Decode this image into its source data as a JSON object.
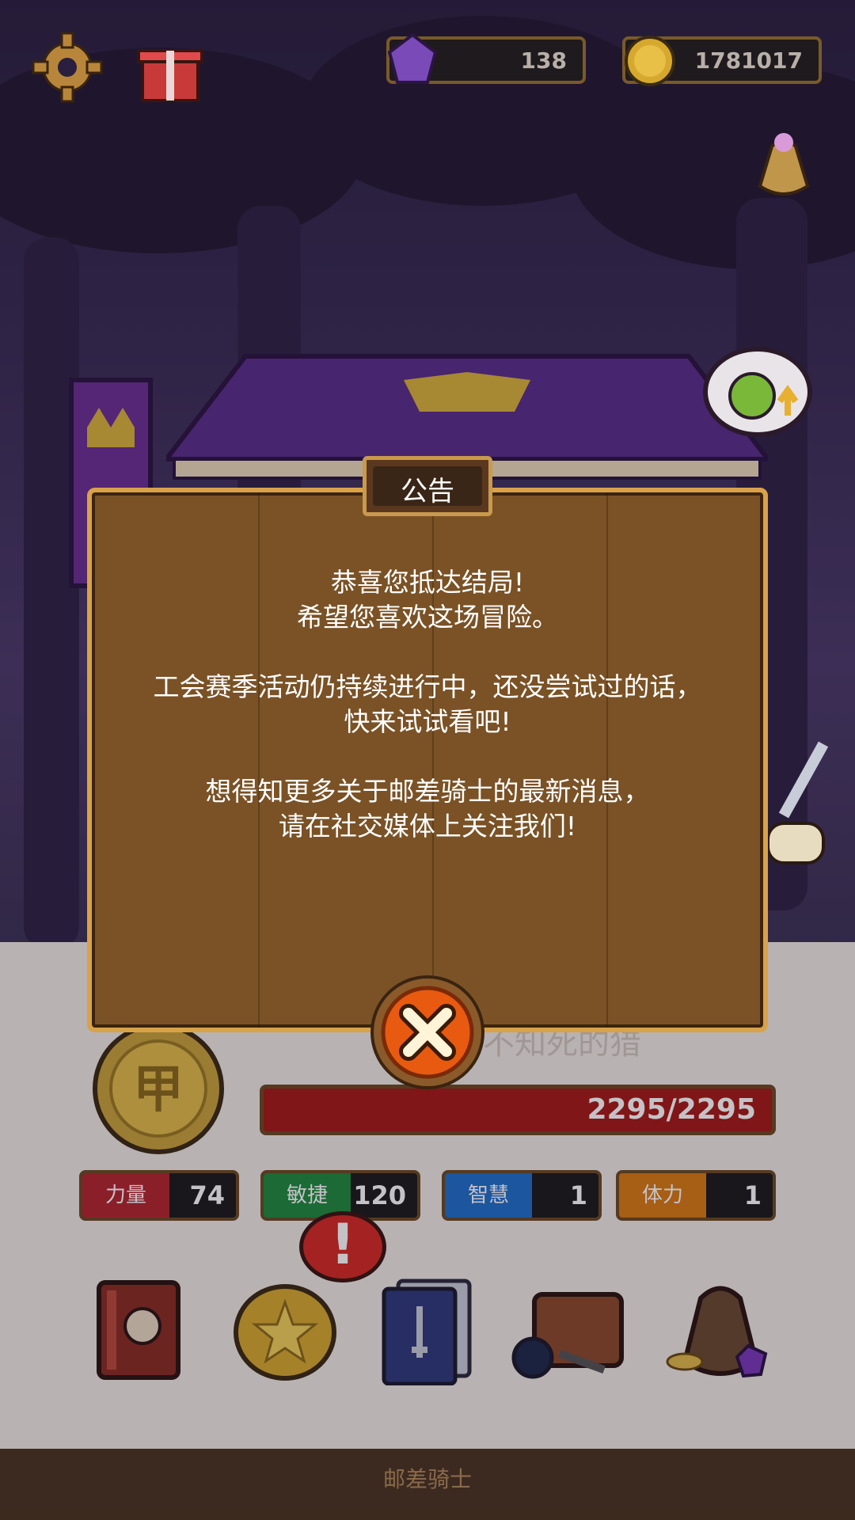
{
  "currencies": {
    "gems": "138",
    "gold": "1781017"
  },
  "dialog": {
    "title": "公告",
    "lines": [
      "恭喜您抵达结局!",
      "希望您喜欢这场冒险。",
      "工会赛季活动仍持续进行中，还没尝试过的话，",
      "快来试试看吧!",
      "想得知更多关于邮差骑士的最新消息，",
      "请在社交媒体上关注我们!"
    ]
  },
  "character": {
    "rank_emblem": "甲",
    "hp": "2295/2295",
    "name_partial": "不知死的猎"
  },
  "stats": [
    {
      "label": "力量",
      "value": "74",
      "color": "#b3262c"
    },
    {
      "label": "敏捷",
      "value": "120",
      "color": "#1f8a3c"
    },
    {
      "label": "智慧",
      "value": "1",
      "color": "#1e6fc8"
    },
    {
      "label": "体力",
      "value": "1",
      "color": "#d97a12"
    }
  ],
  "alert_mark": "!",
  "app_name": "邮差骑士",
  "colors": {
    "dialog_wood": "#7a5226",
    "dialog_border": "#d9a24a",
    "close_button": "#e85a10",
    "hp_bar": "#a41a14"
  }
}
